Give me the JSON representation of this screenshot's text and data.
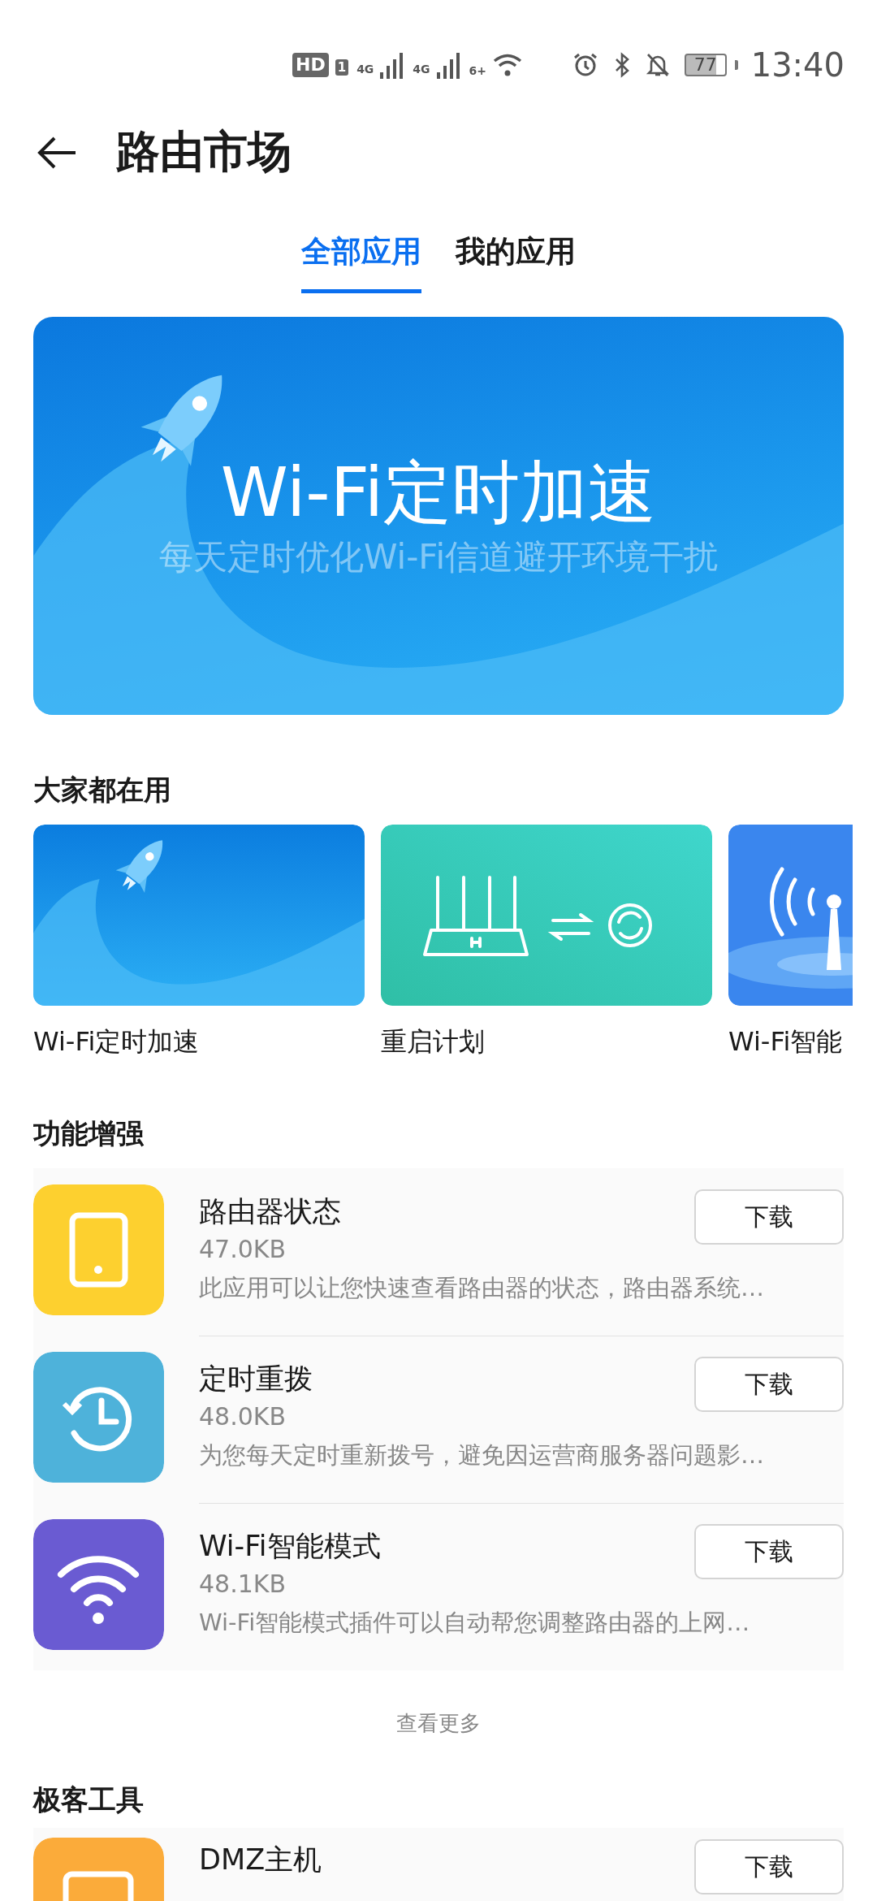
{
  "status_bar": {
    "hd_badge": "HD",
    "sim_slot": "1",
    "network_1": "4G",
    "network_2": "4G",
    "wifi_badge": "6+",
    "battery": "77",
    "time": "13:40"
  },
  "header": {
    "title": "路由市场"
  },
  "tabs": [
    {
      "label": "全部应用",
      "selected": true
    },
    {
      "label": "我的应用",
      "selected": false
    }
  ],
  "banner": {
    "title": "Wi-Fi定时加速",
    "subtitle": "每天定时优化Wi-Fi信道避开环境干扰"
  },
  "popular": {
    "title": "大家都在用",
    "cards": [
      {
        "label": "Wi-Fi定时加速",
        "kind": "rocket"
      },
      {
        "label": "重启计划",
        "kind": "router"
      },
      {
        "label": "Wi-Fi智能",
        "kind": "antenna"
      }
    ]
  },
  "features": {
    "title": "功能增强",
    "apps": [
      {
        "name": "路由器状态",
        "size": "47.0KB",
        "description": "此应用可以让您快速查看路由器的状态，路由器系统…",
        "button": "下载",
        "kind": "tablet",
        "color": "#fdd02f"
      },
      {
        "name": "定时重拨",
        "size": "48.0KB",
        "description": "为您每天定时重新拨号，避免因运营商服务器问题影…",
        "button": "下载",
        "kind": "clock",
        "color": "#4eb2da"
      },
      {
        "name": "Wi-Fi智能模式",
        "size": "48.1KB",
        "description": "Wi-Fi智能模式插件可以自动帮您调整路由器的上网…",
        "button": "下载",
        "kind": "wifi",
        "color": "#6a5bd2"
      }
    ],
    "more": "查看更多"
  },
  "geek": {
    "title": "极客工具",
    "apps": [
      {
        "name": "DMZ主机",
        "button": "下载",
        "kind": "monitor",
        "color": "#fbab3a"
      }
    ]
  }
}
